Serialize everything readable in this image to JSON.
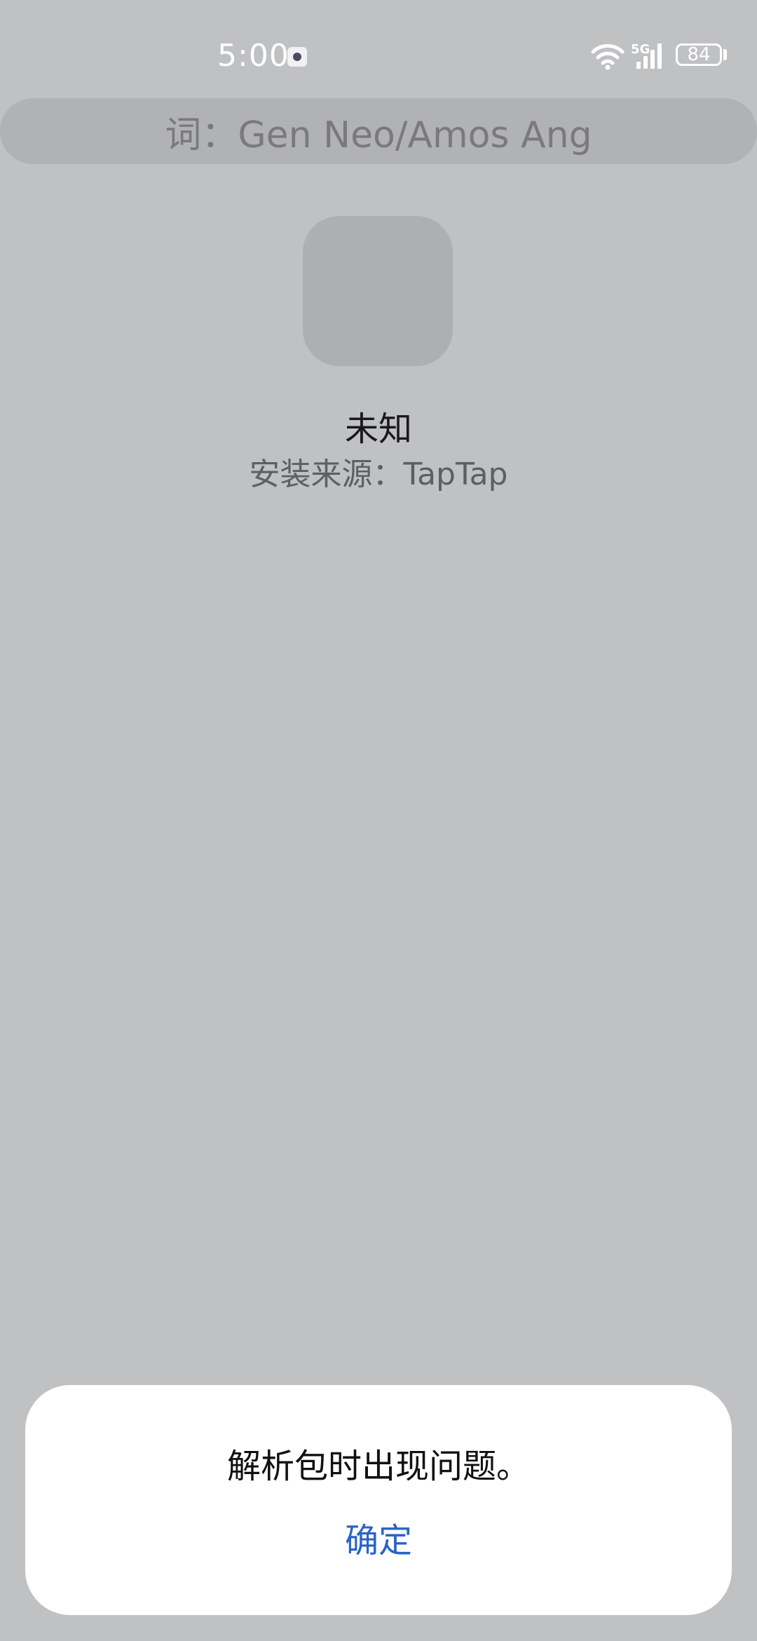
{
  "status_bar": {
    "time": "5:00",
    "network": "5G",
    "battery": "84"
  },
  "lyric": "词：Gen Neo/Amos Ang",
  "app": {
    "name": "未知",
    "install_source": "安装来源：TapTap"
  },
  "dialog": {
    "message": "解析包时出现问题。",
    "confirm_label": "确定"
  },
  "colors": {
    "background": "#c0c1c3",
    "dialog_background": "#ffffff",
    "accent": "#2a63c7"
  },
  "icons": [
    "notification-icon",
    "wifi-icon",
    "signal-icon",
    "battery-icon",
    "app-icon"
  ]
}
